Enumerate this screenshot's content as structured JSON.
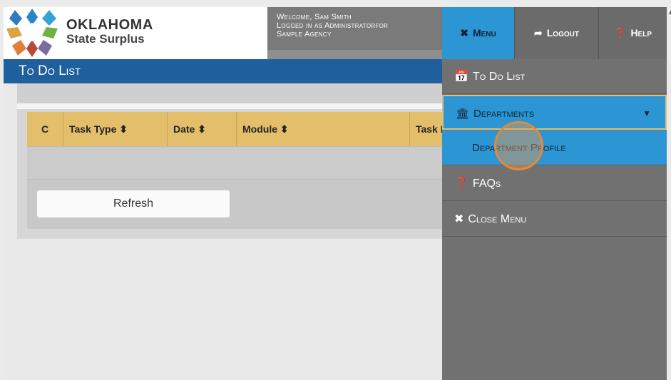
{
  "header": {
    "logo_line1": "OKLAHOMA",
    "logo_line2": "State Surplus",
    "welcome_line1": "Welcome, Sam Smith",
    "welcome_line2": "Logged in as Administratorfor",
    "welcome_line3": "Sample Agency"
  },
  "page": {
    "title": "To Do List"
  },
  "table": {
    "columns": [
      {
        "label": "C"
      },
      {
        "label": "Task Type",
        "sort": "⇕"
      },
      {
        "label": "Date",
        "sort": "⇕"
      },
      {
        "label": "Module",
        "sort": "⇕"
      },
      {
        "label": "Task I"
      }
    ],
    "refresh_label": "Refresh"
  },
  "topnav": {
    "menu": "Menu",
    "logout": "Logout",
    "help": "Help"
  },
  "sidemenu": {
    "todo": "To Do List",
    "departments": "Departments",
    "department_profile": "Department Profile",
    "faqs": "FAQs",
    "close_menu": "Close Menu"
  },
  "colors": {
    "brand_blue": "#1f5f9e",
    "menu_active": "#2c95d3",
    "table_header": "#e3bf6c"
  },
  "icons": {
    "menu": "close-x-icon",
    "logout": "sign-out-icon",
    "help": "question-circle-icon",
    "todo": "calendar-check-icon",
    "departments": "bank-icon",
    "faqs": "question-circle-icon",
    "close_menu": "close-x-icon"
  }
}
